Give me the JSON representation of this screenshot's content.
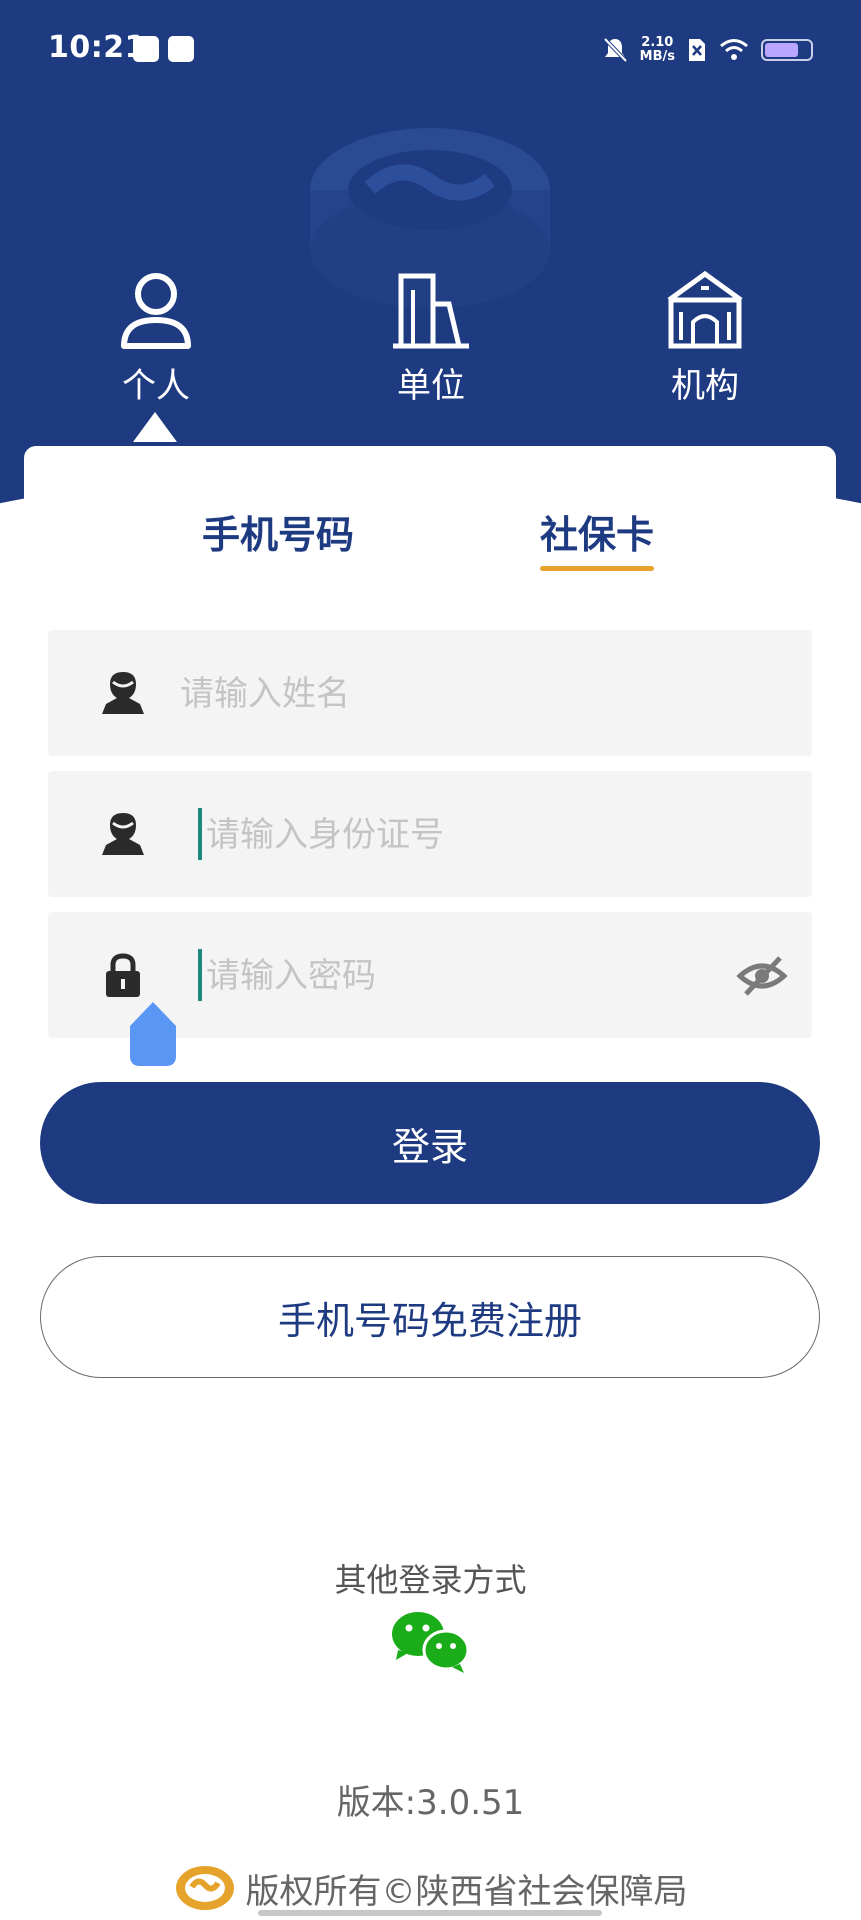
{
  "status_bar": {
    "time": "10:21",
    "net_speed_value": "2.10",
    "net_speed_unit": "MB/s",
    "battery_level": 0.75
  },
  "role_tabs": [
    {
      "label": "个人",
      "icon": "person-icon",
      "active": true
    },
    {
      "label": "单位",
      "icon": "building-icon",
      "active": false
    },
    {
      "label": "机构",
      "icon": "institution-icon",
      "active": false
    }
  ],
  "login_tabs": [
    {
      "label": "手机号码",
      "active": false
    },
    {
      "label": "社保卡",
      "active": true
    }
  ],
  "form": {
    "name_placeholder": "请输入姓名",
    "id_placeholder": "请输入身份证号",
    "password_placeholder": "请输入密码"
  },
  "buttons": {
    "login": "登录",
    "register": "手机号码免费注册"
  },
  "other_login": {
    "label": "其他登录方式",
    "icon": "wechat-icon"
  },
  "footer": {
    "version": "版本:3.0.51",
    "copyright": "版权所有©陕西省社会保障局"
  },
  "colors": {
    "primary": "#1e3b82",
    "accent": "#e6a32b",
    "wechat": "#1aad19"
  }
}
